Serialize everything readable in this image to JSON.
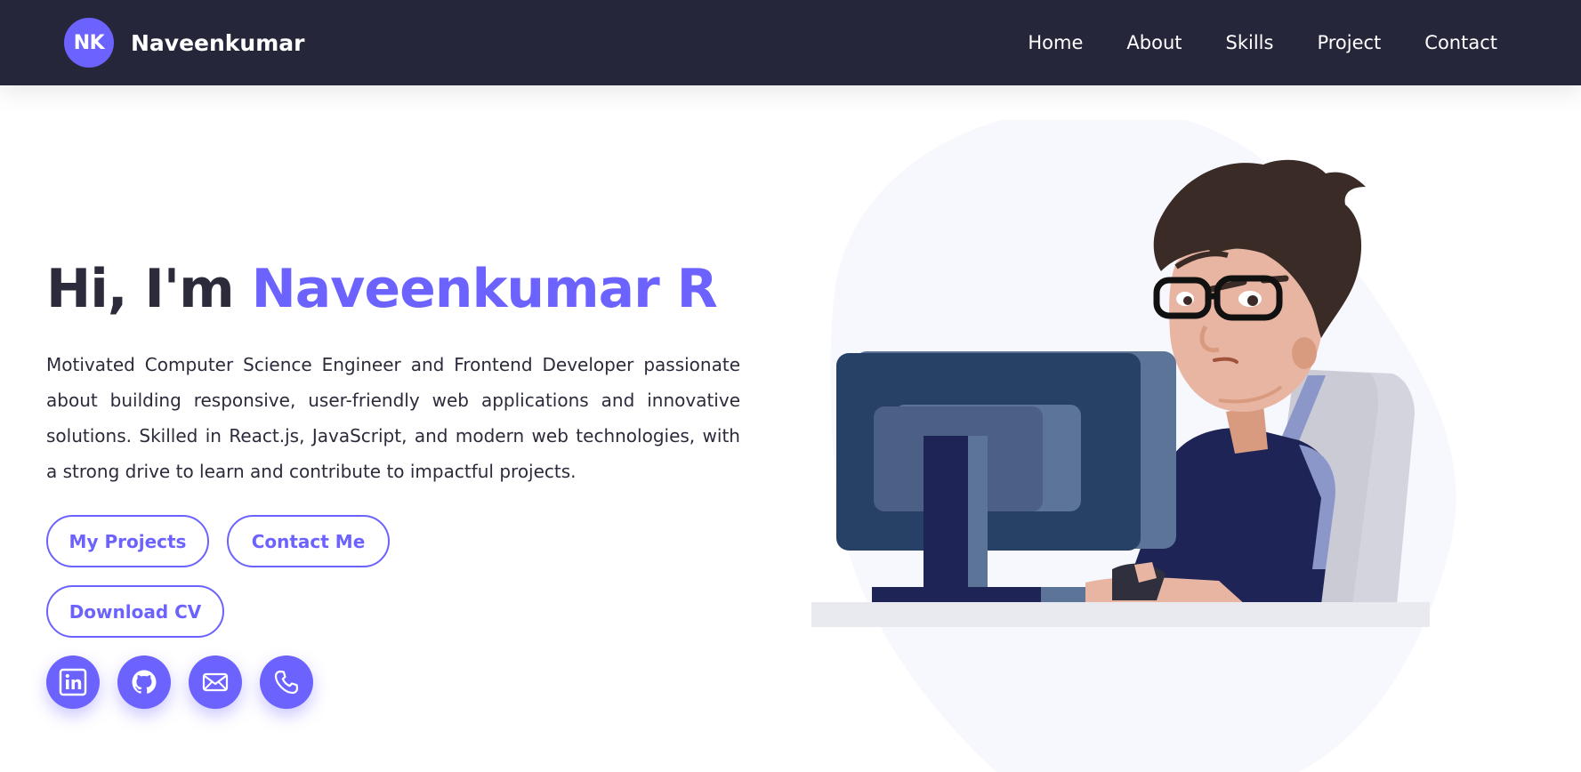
{
  "nav": {
    "logo_text": "NK",
    "brand_name": "Naveenkumar",
    "links": [
      "Home",
      "About",
      "Skills",
      "Project",
      "Contact"
    ]
  },
  "hero": {
    "greeting": "Hi, I'm",
    "name": "Naveenkumar R",
    "description": "Motivated Computer Science Engineer and Frontend Developer passionate about building responsive, user-friendly web applications and innovative solutions. Skilled in React.js, JavaScript, and modern web technologies, with a strong drive to learn and contribute to impactful projects."
  },
  "buttons": {
    "projects": "My Projects",
    "contact": "Contact Me",
    "cv": "Download CV"
  },
  "socials": [
    "linkedin-icon",
    "github-icon",
    "mail-icon",
    "phone-icon"
  ],
  "colors": {
    "accent": "#6c63ff",
    "navbar": "#25263a",
    "text": "#2b2b3c"
  }
}
